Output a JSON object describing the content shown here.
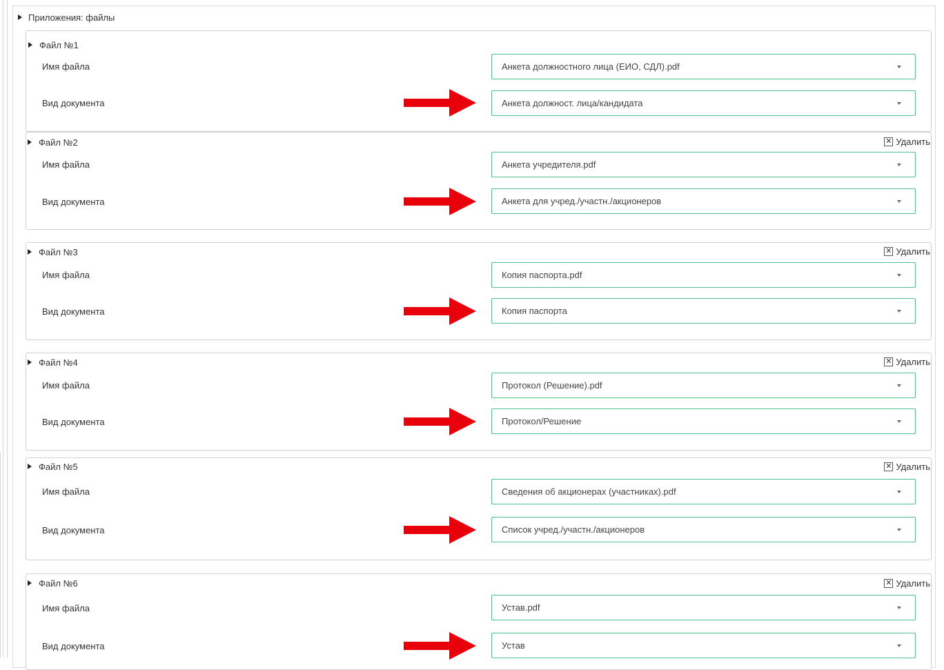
{
  "section": {
    "title": "Приложения: файлы"
  },
  "labels": {
    "file_name": "Имя файла",
    "doc_type": "Вид документа",
    "delete": "Удалить"
  },
  "files": [
    {
      "title": "Файл №1",
      "file_name": "Анкета должностного лица (ЕИО, СДЛ).pdf",
      "doc_type": "Анкета должност. лица/кандидата",
      "deletable": false
    },
    {
      "title": "Файл №2",
      "file_name": "Анкета учредителя.pdf",
      "doc_type": "Анкета для учред./участн./акционеров",
      "deletable": true
    },
    {
      "title": "Файл №3",
      "file_name": "Копия паспорта.pdf",
      "doc_type": "Копия паспорта",
      "deletable": true
    },
    {
      "title": "Файл №4",
      "file_name": "Протокол (Решение).pdf",
      "doc_type": "Протокол/Решение",
      "deletable": true
    },
    {
      "title": "Файл №5",
      "file_name": "Сведения об акционерах (участниках).pdf",
      "doc_type": "Список учред./участн./акционеров",
      "deletable": true
    },
    {
      "title": "Файл №6",
      "file_name": "Устав.pdf",
      "doc_type": "Устав",
      "deletable": true
    }
  ],
  "colors": {
    "select_border": "#4cc18a",
    "arrow": "#e8000b"
  }
}
